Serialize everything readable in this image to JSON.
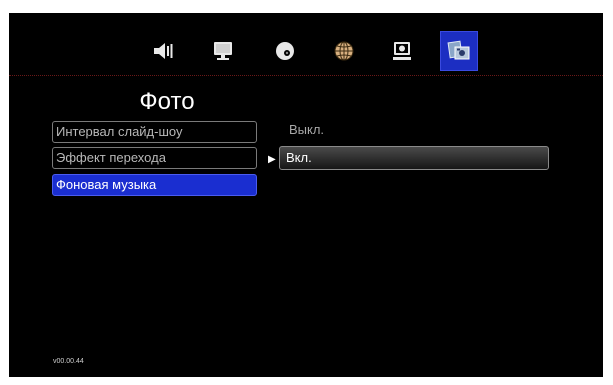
{
  "toolbar": {
    "icons": [
      {
        "name": "audio-icon"
      },
      {
        "name": "display-icon"
      },
      {
        "name": "disc-icon"
      },
      {
        "name": "network-icon"
      },
      {
        "name": "system-icon"
      },
      {
        "name": "photo-icon",
        "active": true
      }
    ],
    "active_color": "#1c2ec2"
  },
  "page": {
    "title": "Фото"
  },
  "menu": {
    "items": [
      {
        "label": "Интервал слайд-шоу"
      },
      {
        "label": "Эффект перехода"
      },
      {
        "label": "Фоновая музыка",
        "selected": true
      }
    ],
    "selected_color": "#1a2ed0"
  },
  "options": {
    "current_value": "Выкл.",
    "highlighted_option": "Вкл."
  },
  "footer": {
    "version": "v00.00.44"
  }
}
